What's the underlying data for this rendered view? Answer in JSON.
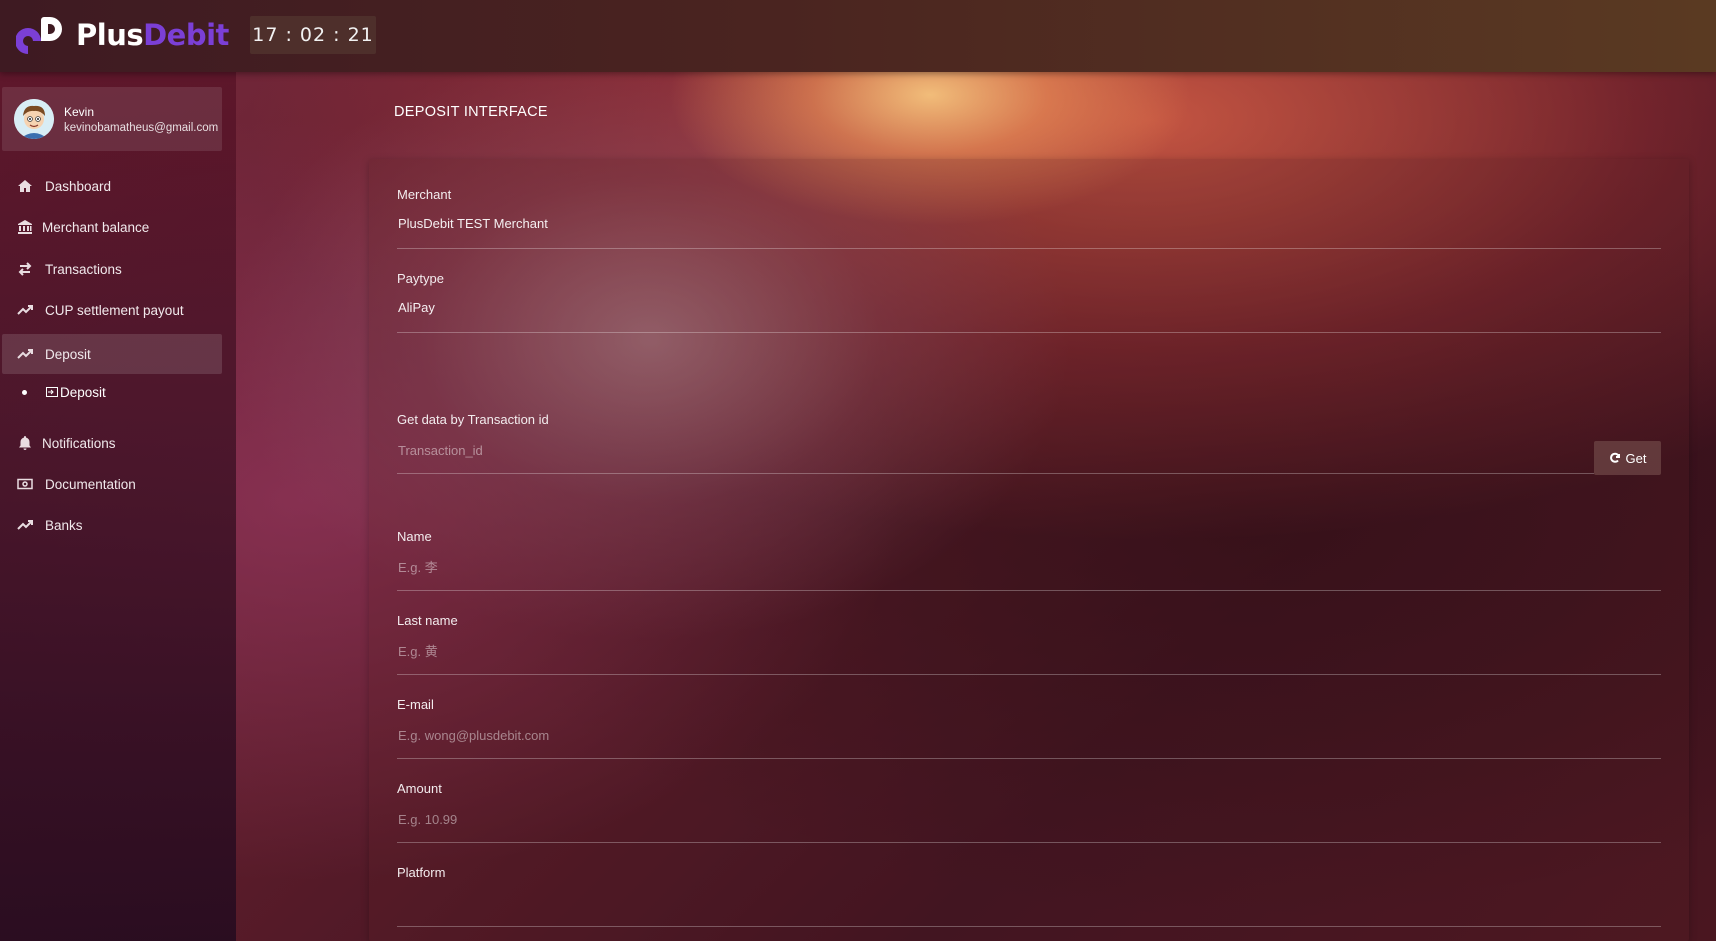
{
  "header": {
    "logo_plus": "Plus",
    "logo_debit": "Debit",
    "clock": "17 : 02 : 21",
    "brand_colors": {
      "plus": "#ffffff",
      "debit": "#7b3fd6"
    }
  },
  "user": {
    "name": "Kevin",
    "email": "kevinobamatheus@gmail.com"
  },
  "sidebar": {
    "items": [
      {
        "label": "Dashboard",
        "icon": "home-icon"
      },
      {
        "label": "Merchant balance",
        "icon": "bank-icon"
      },
      {
        "label": "Transactions",
        "icon": "swap-arrows-icon"
      },
      {
        "label": "CUP settlement payout",
        "icon": "trending-up-icon"
      },
      {
        "label": "Deposit",
        "icon": "trending-up-icon",
        "active": true
      },
      {
        "label": "Notifications",
        "icon": "bell-icon"
      },
      {
        "label": "Documentation",
        "icon": "money-bill-icon"
      },
      {
        "label": "Banks",
        "icon": "trending-up-icon"
      }
    ],
    "sub_items": [
      {
        "label": "Deposit",
        "icon": "login-box-icon"
      }
    ]
  },
  "page": {
    "title": "DEPOSIT INTERFACE"
  },
  "form": {
    "merchant": {
      "label": "Merchant",
      "value": "PlusDebit TEST Merchant"
    },
    "paytype": {
      "label": "Paytype",
      "value": "AliPay"
    },
    "transaction": {
      "label": "Get data by Transaction id",
      "placeholder": "Transaction_id",
      "button": "Get"
    },
    "name": {
      "label": "Name",
      "placeholder": "E.g. 李"
    },
    "last_name": {
      "label": "Last name",
      "placeholder": "E.g. 黄"
    },
    "email": {
      "label": "E-mail",
      "placeholder": "E.g. wong@plusdebit.com"
    },
    "amount": {
      "label": "Amount",
      "placeholder": "E.g. 10.99"
    },
    "platform": {
      "label": "Platform",
      "value": ""
    }
  }
}
